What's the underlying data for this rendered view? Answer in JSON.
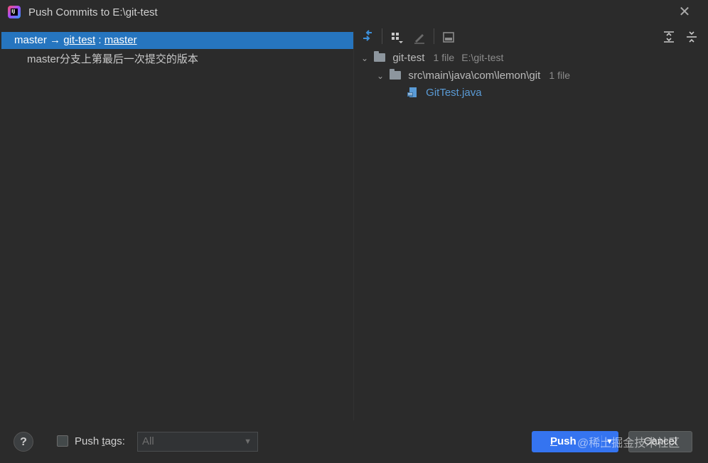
{
  "window": {
    "title": "Push Commits to E:\\git-test",
    "app_icon": "intellij-idea-icon",
    "close_icon": "close-icon"
  },
  "left_pane": {
    "branch_row": {
      "local": "master",
      "arrow": "→",
      "remote": "git-test",
      "separator": ":",
      "target": "master"
    },
    "commit_message": "master分支上第最后一次提交的版本"
  },
  "toolbar": {
    "icons": [
      "diff-icon",
      "group-by-icon",
      "edit-icon",
      "preview-icon",
      "expand-all-icon",
      "collapse-all-icon"
    ]
  },
  "tree": {
    "root": {
      "name": "git-test",
      "count": "1 file",
      "path": "E:\\git-test"
    },
    "folder": {
      "name": "src\\main\\java\\com\\lemon\\git",
      "count": "1 file"
    },
    "file": {
      "name": "GitTest.java"
    }
  },
  "footer": {
    "help_label": "?",
    "push_tags_prefix": "Push ",
    "push_tags_underlined": "t",
    "push_tags_suffix": "ags:",
    "tags_select_value": "All",
    "push_underlined": "P",
    "push_rest": "ush",
    "cancel_label": "Cancel",
    "watermark": "@稀土掘金技术社区"
  },
  "colors": {
    "background": "#2b2b2b",
    "selection": "#2675bf",
    "primary_button": "#3574f0",
    "file_link": "#5a9bd6"
  }
}
